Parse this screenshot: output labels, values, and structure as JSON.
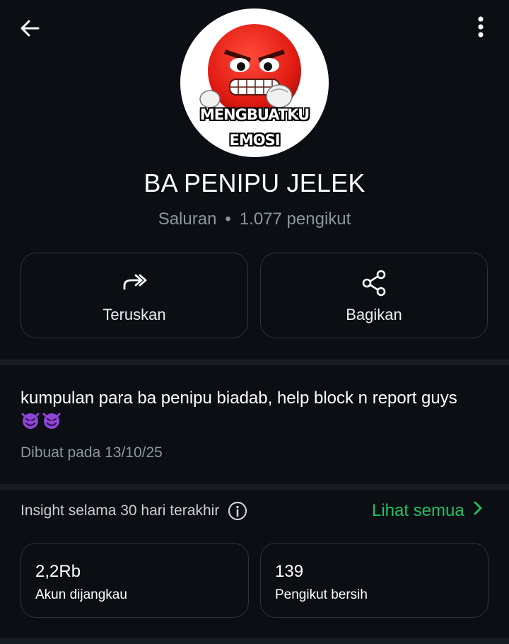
{
  "header": {
    "back_icon": "arrow-left-icon",
    "menu_icon": "more-vertical-icon"
  },
  "avatar": {
    "caption_line1": "MENGBUATKU",
    "caption_line2": "EMOSI"
  },
  "channel": {
    "name": "BA PENIPU JELEK",
    "type": "Saluran",
    "separator": "•",
    "followers": "1.077 pengikut"
  },
  "actions": {
    "forward_label": "Teruskan",
    "forward_icon": "forward-icon",
    "share_label": "Bagikan",
    "share_icon": "share-icon"
  },
  "about": {
    "description": "kumpulan para ba penipu biadab, help block n report guys",
    "emojis": [
      "smiling-devil-emoji",
      "smiling-devil-emoji"
    ],
    "created": "Dibuat pada 13/10/25"
  },
  "insights": {
    "label": "Insight selama 30 hari terakhir",
    "info_icon": "info-icon",
    "see_all": "Lihat semua",
    "see_all_icon": "chevron-right-icon",
    "stats": [
      {
        "value": "2,2Rb",
        "caption": "Akun dijangkau"
      },
      {
        "value": "139",
        "caption": "Pengikut bersih"
      }
    ]
  },
  "colors": {
    "background": "#0b0f14",
    "accent_green": "#21c063",
    "muted_text": "#8b979d",
    "card_border": "#2c353b"
  }
}
